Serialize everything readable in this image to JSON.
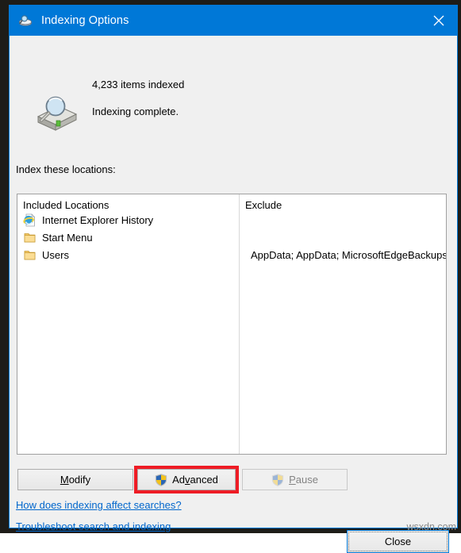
{
  "window": {
    "title": "Indexing Options",
    "title_icon": "indexing-options-icon",
    "close_icon": "close-icon",
    "accent_color": "#0078d7",
    "background_color": "#f0f0f0"
  },
  "status": {
    "icon": "hard-drive-search-icon",
    "items_indexed": "4,233 items indexed",
    "state": "Indexing complete."
  },
  "locations": {
    "section_label": "Index these locations:",
    "columns": [
      {
        "header": "Included Locations"
      },
      {
        "header": "Exclude"
      }
    ],
    "rows": [
      {
        "icon": "internet-explorer-icon",
        "name": "Internet Explorer History",
        "exclude": ""
      },
      {
        "icon": "folder-icon",
        "name": "Start Menu",
        "exclude": ""
      },
      {
        "icon": "folder-icon",
        "name": "Users",
        "exclude": "AppData; AppData; MicrosoftEdgeBackups"
      }
    ]
  },
  "buttons": {
    "modify": {
      "label_before": "",
      "label_accel": "M",
      "label_after": "odify",
      "enabled": true
    },
    "advanced": {
      "label_before": "Ad",
      "label_accel": "v",
      "label_after": "anced",
      "enabled": true,
      "icon": "uac-shield-icon",
      "highlighted": true,
      "highlight_color": "#ee1c25"
    },
    "pause": {
      "label_before": "",
      "label_accel": "P",
      "label_after": "ause",
      "enabled": false,
      "icon": "uac-shield-icon"
    },
    "close": {
      "label": "Close",
      "focused": true
    }
  },
  "links": [
    {
      "label": "How does indexing affect searches?",
      "color": "#0066cc"
    },
    {
      "label": "Troubleshoot search and indexing",
      "color": "#0066cc"
    }
  ],
  "watermark": {
    "text": "wsxdn.com"
  }
}
